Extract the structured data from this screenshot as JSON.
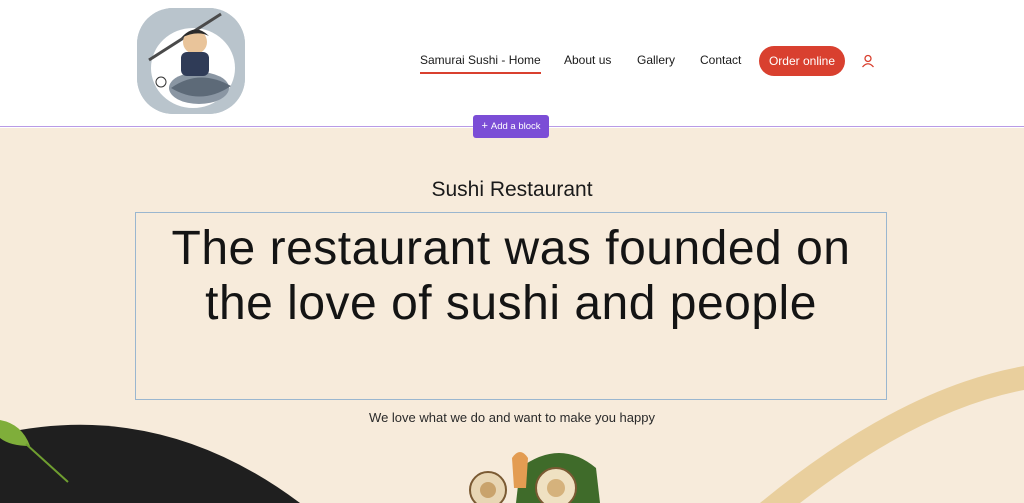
{
  "nav": {
    "items": [
      {
        "label": "Samurai Sushi - Home",
        "active": true
      },
      {
        "label": "About us",
        "active": false
      },
      {
        "label": "Gallery",
        "active": false
      },
      {
        "label": "Contact",
        "active": false
      }
    ],
    "order_label": "Order online",
    "user_icon": "user-icon"
  },
  "editor": {
    "add_block_label": "Add a block",
    "add_block_icon": "plus-icon"
  },
  "hero": {
    "eyebrow": "Sushi Restaurant",
    "headline": "The restaurant was founded on the love of sushi and people",
    "tagline": "We love what we do and want to make you happy"
  },
  "colors": {
    "accent": "#d9402f",
    "editor_purple": "#7b4dd6",
    "hero_bg": "#f7ebdb",
    "dark_wave": "#1f1f1f",
    "gold_wave": "#e9cf9d"
  }
}
